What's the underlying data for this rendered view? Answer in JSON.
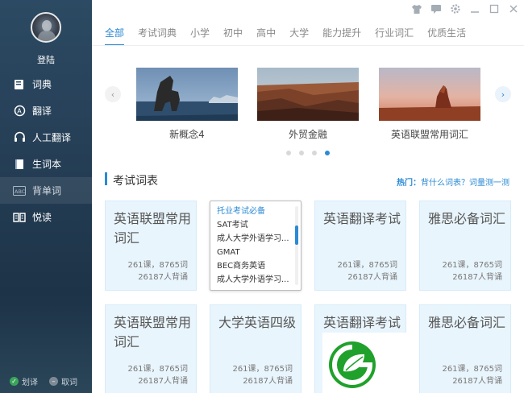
{
  "sidebar": {
    "login_label": "登陆",
    "items": [
      {
        "label": "词典",
        "icon": "dictionary-icon"
      },
      {
        "label": "翻译",
        "icon": "translate-icon"
      },
      {
        "label": "人工翻译",
        "icon": "headset-icon"
      },
      {
        "label": "生词本",
        "icon": "notebook-icon"
      },
      {
        "label": "背单词",
        "icon": "abc-icon"
      },
      {
        "label": "悦读",
        "icon": "book-icon"
      }
    ],
    "bottom": {
      "left_label": "划译",
      "right_label": "取词"
    }
  },
  "window_controls": [
    "skin-icon",
    "message-icon",
    "settings-icon",
    "minimize-icon",
    "maximize-icon",
    "close-icon"
  ],
  "tabs": [
    "全部",
    "考试词典",
    "小学",
    "初中",
    "高中",
    "大学",
    "能力提升",
    "行业词汇",
    "优质生活"
  ],
  "active_tab": "全部",
  "carousel": {
    "slides": [
      {
        "caption": "新概念4"
      },
      {
        "caption": "外贸金融"
      },
      {
        "caption": "英语联盟常用词汇"
      }
    ],
    "page_count": 4,
    "active_page": 4
  },
  "section": {
    "title": "考试词表",
    "hot_label": "热门：",
    "hot_link1": "背什么词表？",
    "hot_link2": "词量测一测"
  },
  "cards_row1": [
    {
      "title": "英语联盟常用词汇",
      "lessons": "261课，8765词",
      "learners": "26187人背诵"
    },
    {
      "list": [
        "托业考试必备",
        "SAT考试",
        "成人大学外语学习...",
        "GMAT",
        "BEC商务英语",
        "成人大学外语学习..."
      ]
    },
    {
      "title": "英语翻译考试",
      "lessons": "261课，8765词",
      "learners": "26187人背诵"
    },
    {
      "title": "雅思必备词汇",
      "lessons": "261课，8765词",
      "learners": "26187人背诵"
    }
  ],
  "cards_row2": [
    {
      "title": "英语联盟常用词汇",
      "lessons": "261课，8765词",
      "learners": "26187人背诵"
    },
    {
      "title": "大学英语四级",
      "lessons": "261课，8765词",
      "learners": "26187人背诵"
    },
    {
      "title": "英语翻译考试",
      "lessons": "",
      "learners": ""
    },
    {
      "title": "雅思必备词汇",
      "lessons": "261课，8765词",
      "learners": "26187人背诵"
    }
  ],
  "colors": {
    "accent": "#2a8ad4",
    "sidebar": "#243d54",
    "card_bg": "#e9f5fd",
    "logo_green": "#1fa12b"
  }
}
